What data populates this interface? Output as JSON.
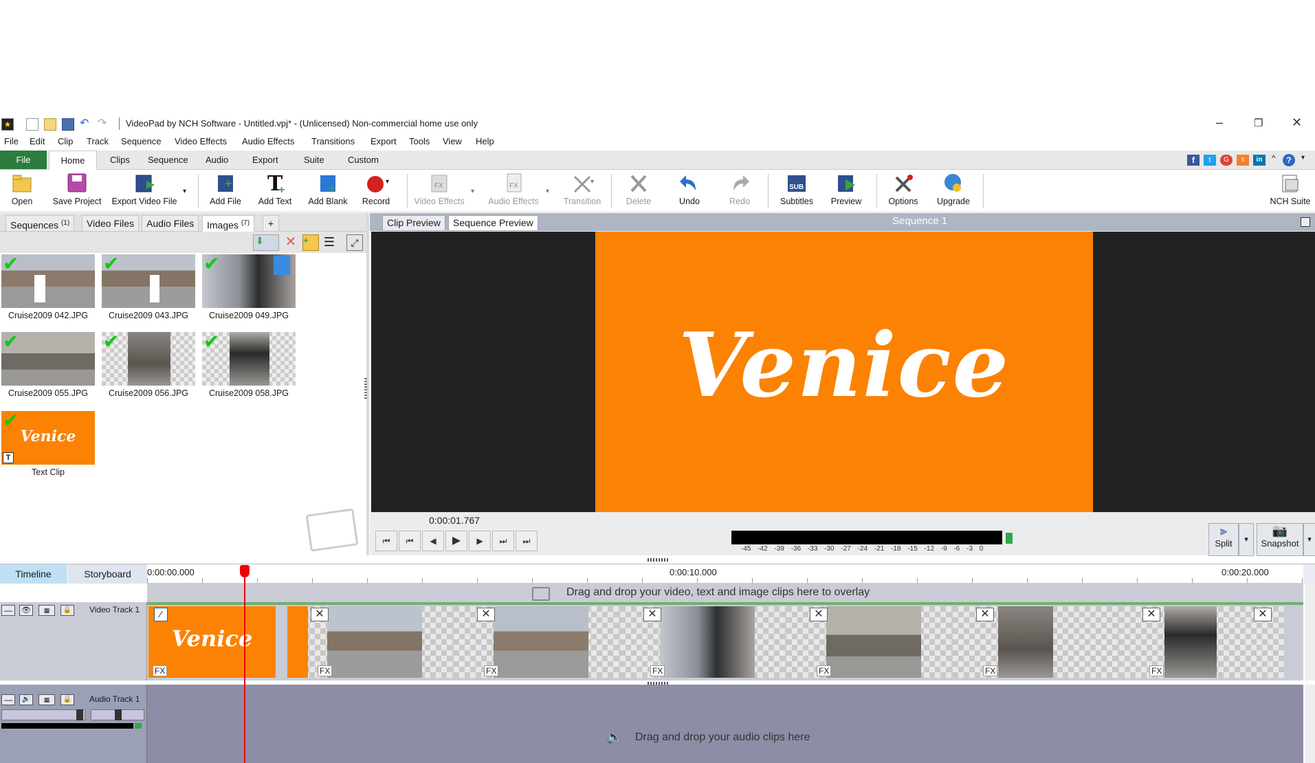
{
  "window": {
    "title": "VideoPad by NCH Software - Untitled.vpj* - (Unlicensed) Non-commercial home use only"
  },
  "menu": [
    "File",
    "Edit",
    "Clip",
    "Track",
    "Sequence",
    "Video Effects",
    "Audio Effects",
    "Transitions",
    "Export",
    "Tools",
    "View",
    "Help"
  ],
  "ribbon_tabs": [
    "File",
    "Home",
    "Clips",
    "Sequence",
    "Audio",
    "Export",
    "Suite",
    "Custom"
  ],
  "toolbar": {
    "open": "Open",
    "save_project": "Save Project",
    "export_video": "Export Video File",
    "add_file": "Add File",
    "add_text": "Add Text",
    "add_blank": "Add Blank",
    "record": "Record",
    "video_effects": "Video Effects",
    "audio_effects": "Audio Effects",
    "transition": "Transition",
    "delete": "Delete",
    "undo": "Undo",
    "redo": "Redo",
    "subtitles": "Subtitles",
    "preview": "Preview",
    "options": "Options",
    "upgrade": "Upgrade",
    "nch_suite": "NCH Suite"
  },
  "bins": {
    "tabs": [
      {
        "label": "Sequences",
        "count": "(1)"
      },
      {
        "label": "Video Files",
        "count": ""
      },
      {
        "label": "Audio Files",
        "count": ""
      },
      {
        "label": "Images",
        "count": "(7)"
      }
    ],
    "items": [
      "Cruise2009 042.JPG",
      "Cruise2009 043.JPG",
      "Cruise2009 049.JPG",
      "Cruise2009 055.JPG",
      "Cruise2009 056.JPG",
      "Cruise2009 058.JPG",
      "Text Clip"
    ],
    "text_clip_word": "Venice"
  },
  "preview": {
    "tabs": [
      "Clip Preview",
      "Sequence Preview"
    ],
    "sequence_title": "Sequence 1",
    "overlay_text": "Venice",
    "timecode": "0:00:01.767",
    "meter_scale": "-45 -42 -39 -36 -33 -30 -27 -24 -21 -18 -15 -12 -9 -6 -3 0",
    "split": "Split",
    "snapshot": "Snapshot"
  },
  "timeline": {
    "tabs": [
      "Timeline",
      "Storyboard"
    ],
    "timecodes": [
      "0:00:00.000",
      "0:00:10.000",
      "0:00:20.000"
    ],
    "overlay_hint": "Drag and drop your video, text and image clips here to overlay",
    "video_track_label": "Video Track 1",
    "audio_track_label": "Audio Track 1",
    "audio_hint": "Drag and drop your audio clips here",
    "fx_label": "FX",
    "clip_title": "Venice"
  },
  "colors": {
    "accent_orange": "#fb8203",
    "file_tab_green": "#2b7d3f",
    "playhead_red": "#e00000"
  }
}
